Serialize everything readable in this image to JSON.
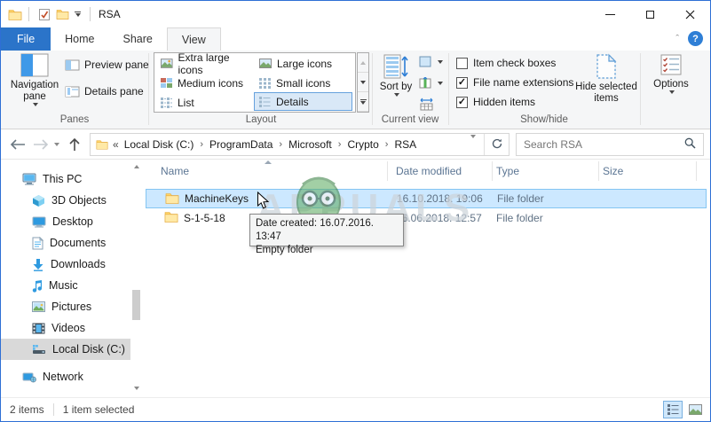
{
  "window": {
    "title": "RSA"
  },
  "tabs": {
    "file": "File",
    "home": "Home",
    "share": "Share",
    "view": "View"
  },
  "ribbon": {
    "panes": {
      "label": "Panes",
      "navigation_pane": "Navigation pane",
      "preview_pane": "Preview pane",
      "details_pane": "Details pane"
    },
    "layout": {
      "label": "Layout",
      "extra_large": "Extra large icons",
      "large": "Large icons",
      "medium": "Medium icons",
      "small": "Small icons",
      "list": "List",
      "details": "Details",
      "selected": "Details"
    },
    "current_view": {
      "label": "Current view",
      "sort_by": "Sort by"
    },
    "show_hide": {
      "label": "Show/hide",
      "item_check_boxes": "Item check boxes",
      "file_name_extensions": "File name extensions",
      "hidden_items": "Hidden items",
      "hide_selected_items": "Hide selected items",
      "checked": {
        "item_check_boxes": false,
        "file_name_extensions": true,
        "hidden_items": true
      }
    },
    "options": {
      "label": "Options"
    }
  },
  "address_bar": {
    "overflow": "«",
    "breadcrumbs": [
      "Local Disk (C:)",
      "ProgramData",
      "Microsoft",
      "Crypto",
      "RSA"
    ],
    "search_placeholder": "Search RSA"
  },
  "sidebar": {
    "items": [
      {
        "label": "This PC"
      },
      {
        "label": "3D Objects"
      },
      {
        "label": "Desktop"
      },
      {
        "label": "Documents"
      },
      {
        "label": "Downloads"
      },
      {
        "label": "Music"
      },
      {
        "label": "Pictures"
      },
      {
        "label": "Videos"
      },
      {
        "label": "Local Disk (C:)",
        "selected": true
      },
      {
        "label": "Network"
      }
    ]
  },
  "file_list": {
    "columns": [
      "Name",
      "Date modified",
      "Type",
      "Size"
    ],
    "rows": [
      {
        "name": "MachineKeys",
        "date_modified": "16.10.2018. 19:06",
        "type": "File folder",
        "size": "",
        "selected": true
      },
      {
        "name": "S-1-5-18",
        "date_modified": "16.06.2018. 12:57",
        "type": "File folder",
        "size": "",
        "selected": false
      }
    ]
  },
  "tooltip": {
    "line1": "Date created: 16.07.2016. 13:47",
    "line2": "Empty folder"
  },
  "watermark": "APPUALS",
  "status_bar": {
    "items_count": "2 items",
    "selection_count": "1 item selected"
  },
  "colors": {
    "accent_blue": "#2b74c9",
    "selection_fill": "#cce8ff",
    "selection_border": "#84c5f2",
    "window_border": "#2e6fd5",
    "sidebar_selected": "#d9d9d9"
  }
}
